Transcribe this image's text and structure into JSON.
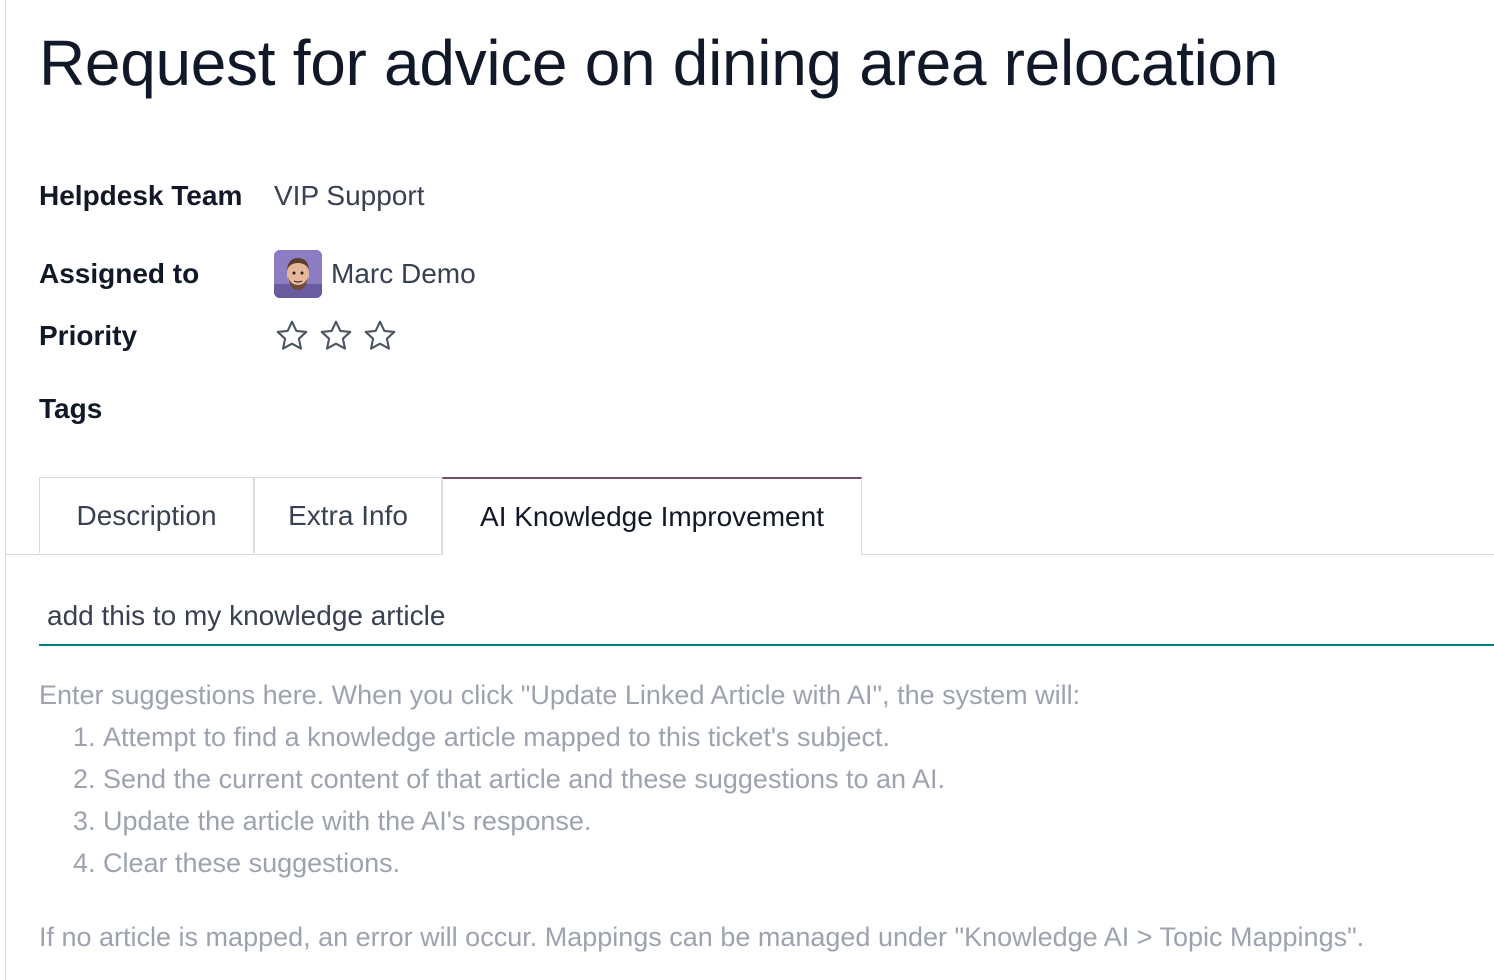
{
  "record": {
    "title": "Request for advice on dining area relocation"
  },
  "fields": {
    "helpdesk_team": {
      "label": "Helpdesk Team",
      "value": "VIP Support"
    },
    "assigned_to": {
      "label": "Assigned to",
      "value": "Marc Demo"
    },
    "priority": {
      "label": "Priority",
      "stars_filled": 0,
      "stars_total": 3
    },
    "tags": {
      "label": "Tags",
      "value": ""
    }
  },
  "tabs": [
    {
      "label": "Description",
      "active": false
    },
    {
      "label": "Extra Info",
      "active": false
    },
    {
      "label": "AI Knowledge Improvement",
      "active": true
    }
  ],
  "ai_tab": {
    "suggestions_value": "add this to my knowledge article",
    "help_intro": "Enter suggestions here. When you click \"Update Linked Article with AI\", the system will:",
    "help_steps": [
      "Attempt to find a knowledge article mapped to this ticket's subject.",
      "Send the current content of that article and these suggestions to an AI.",
      "Update the article with the AI's response.",
      "Clear these suggestions."
    ],
    "help_footer": "If no article is mapped, an error will occur. Mappings can be managed under \"Knowledge AI > Topic Mappings\"."
  },
  "colors": {
    "active_tab_accent": "#714b67",
    "input_underline": "#017e84",
    "help_text": "#9ca3af"
  },
  "icons": {
    "avatar": "user-avatar",
    "priority_star": "star-outline-icon"
  }
}
